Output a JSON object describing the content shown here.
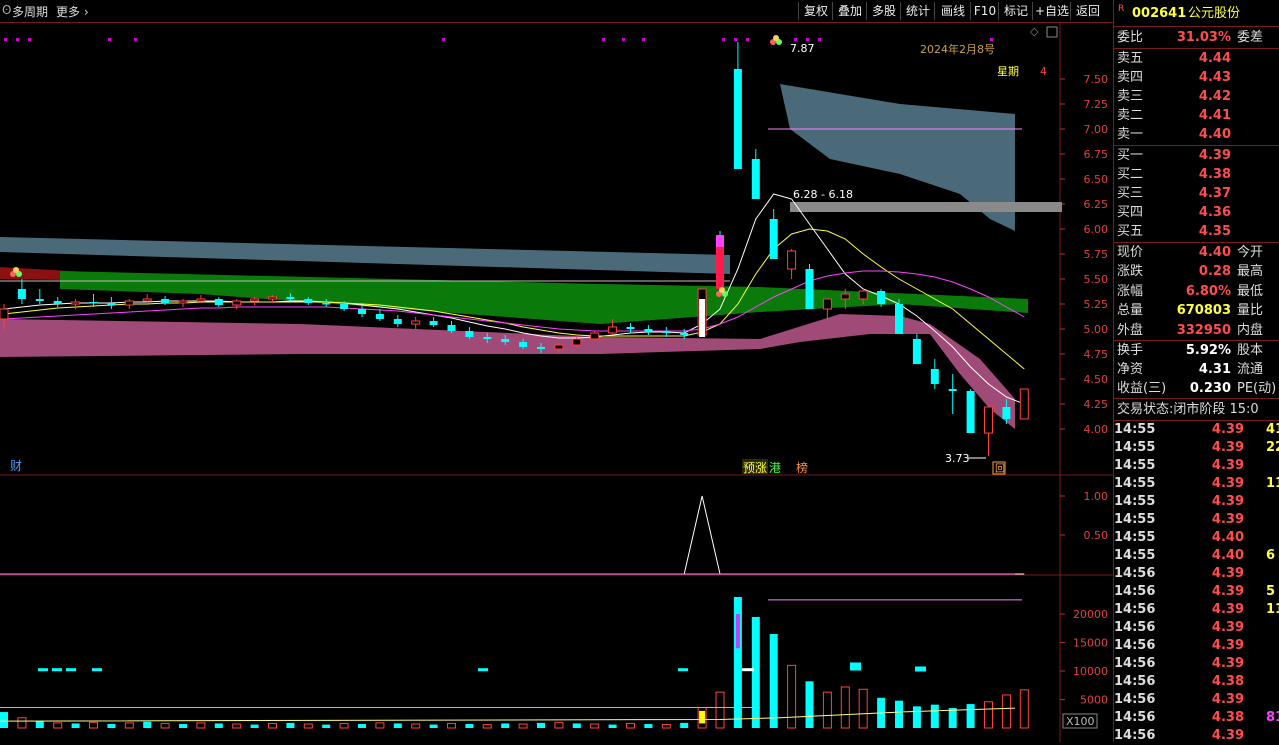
{
  "toolbar": {
    "menu_label": "多周期",
    "more_label": "更多",
    "buttons": [
      "复权",
      "叠加",
      "多股",
      "统计",
      "画线",
      "F10",
      "标记",
      "+自选",
      "返回"
    ]
  },
  "header": {
    "date_label": "2024年2月8号",
    "weekday_label": "星期",
    "weekday_value": "4",
    "high_label": "7.87",
    "low_label": "3.73",
    "range_label": "6.28 - 6.18"
  },
  "markers": {
    "cai": "财",
    "yuzhang": "预涨",
    "gang": "港",
    "bang": "榜",
    "hui": "回",
    "x100": "X100"
  },
  "chart_data": [
    {
      "type": "candlestick",
      "name": "main",
      "ylim": [
        3.6,
        8.0
      ],
      "yticks": [
        4.0,
        4.25,
        4.5,
        4.75,
        5.0,
        5.25,
        5.5,
        5.75,
        6.0,
        6.25,
        6.5,
        6.75,
        7.0,
        7.25,
        7.5
      ],
      "candles": [
        [
          5.1,
          5.25,
          5.0,
          5.2
        ],
        [
          5.4,
          5.5,
          5.25,
          5.3
        ],
        [
          5.3,
          5.4,
          5.25,
          5.28
        ],
        [
          5.28,
          5.32,
          5.22,
          5.25
        ],
        [
          5.25,
          5.3,
          5.2,
          5.27
        ],
        [
          5.27,
          5.35,
          5.22,
          5.26
        ],
        [
          5.26,
          5.32,
          5.2,
          5.24
        ],
        [
          5.24,
          5.3,
          5.2,
          5.28
        ],
        [
          5.28,
          5.35,
          5.25,
          5.3
        ],
        [
          5.3,
          5.33,
          5.24,
          5.26
        ],
        [
          5.26,
          5.3,
          5.22,
          5.28
        ],
        [
          5.28,
          5.34,
          5.26,
          5.3
        ],
        [
          5.3,
          5.32,
          5.22,
          5.24
        ],
        [
          5.24,
          5.3,
          5.2,
          5.28
        ],
        [
          5.28,
          5.32,
          5.24,
          5.3
        ],
        [
          5.3,
          5.34,
          5.26,
          5.32
        ],
        [
          5.32,
          5.36,
          5.28,
          5.3
        ],
        [
          5.3,
          5.32,
          5.24,
          5.26
        ],
        [
          5.26,
          5.3,
          5.22,
          5.25
        ],
        [
          5.25,
          5.28,
          5.18,
          5.2
        ],
        [
          5.2,
          5.24,
          5.12,
          5.15
        ],
        [
          5.15,
          5.2,
          5.08,
          5.1
        ],
        [
          5.1,
          5.14,
          5.02,
          5.05
        ],
        [
          5.05,
          5.12,
          5.0,
          5.08
        ],
        [
          5.08,
          5.12,
          5.02,
          5.04
        ],
        [
          5.04,
          5.08,
          4.96,
          4.98
        ],
        [
          4.98,
          5.02,
          4.9,
          4.92
        ],
        [
          4.92,
          4.96,
          4.86,
          4.9
        ],
        [
          4.9,
          4.94,
          4.84,
          4.87
        ],
        [
          4.87,
          4.9,
          4.8,
          4.82
        ],
        [
          4.82,
          4.86,
          4.76,
          4.8
        ],
        [
          4.8,
          4.86,
          4.76,
          4.84
        ],
        [
          4.84,
          4.92,
          4.82,
          4.9
        ],
        [
          4.9,
          4.98,
          4.88,
          4.96
        ],
        [
          4.96,
          5.1,
          4.94,
          5.02
        ],
        [
          5.02,
          5.06,
          4.96,
          5.0
        ],
        [
          5.0,
          5.04,
          4.94,
          4.98
        ],
        [
          4.98,
          5.02,
          4.92,
          4.96
        ],
        [
          4.96,
          5.0,
          4.9,
          4.94
        ],
        [
          4.94,
          5.4,
          4.92,
          5.4
        ],
        [
          5.94,
          5.98,
          5.4,
          5.4
        ],
        [
          7.6,
          7.87,
          6.6,
          6.6
        ],
        [
          6.7,
          6.8,
          6.3,
          6.3
        ],
        [
          6.1,
          6.2,
          5.7,
          5.7
        ],
        [
          5.6,
          5.8,
          5.5,
          5.78
        ],
        [
          5.6,
          5.65,
          5.2,
          5.2
        ],
        [
          5.2,
          5.3,
          5.1,
          5.3
        ],
        [
          5.3,
          5.4,
          5.2,
          5.35
        ],
        [
          5.3,
          5.4,
          5.25,
          5.38
        ],
        [
          5.38,
          5.4,
          5.22,
          5.25
        ],
        [
          5.25,
          5.3,
          4.95,
          4.95
        ],
        [
          4.9,
          4.95,
          4.65,
          4.65
        ],
        [
          4.6,
          4.7,
          4.4,
          4.45
        ],
        [
          4.4,
          4.55,
          4.15,
          4.38
        ],
        [
          4.38,
          4.4,
          3.96,
          3.96
        ],
        [
          3.96,
          4.22,
          3.73,
          4.22
        ],
        [
          4.22,
          4.3,
          4.05,
          4.1
        ],
        [
          4.1,
          4.4,
          4.1,
          4.4
        ]
      ],
      "ma": [
        [
          5.2,
          5.22,
          5.24,
          5.25,
          5.26,
          5.26,
          5.26,
          5.27,
          5.27,
          5.28,
          5.28,
          5.28,
          5.28,
          5.27,
          5.27,
          5.27,
          5.28,
          5.28,
          5.27,
          5.26,
          5.24,
          5.22,
          5.2,
          5.17,
          5.14,
          5.11,
          5.07,
          5.03,
          5.0,
          4.96,
          4.93,
          4.91,
          4.91,
          4.92,
          4.94,
          4.96,
          4.97,
          4.97,
          4.96,
          5.05,
          5.2,
          5.6,
          6.1,
          6.35,
          6.3,
          6.05,
          5.8,
          5.55,
          5.4,
          5.33,
          5.25,
          5.13,
          4.98,
          4.82,
          4.62,
          4.45,
          4.32,
          4.25
        ],
        [
          5.15,
          5.17,
          5.19,
          5.21,
          5.22,
          5.23,
          5.24,
          5.25,
          5.25,
          5.26,
          5.26,
          5.27,
          5.27,
          5.27,
          5.27,
          5.27,
          5.27,
          5.27,
          5.27,
          5.26,
          5.25,
          5.24,
          5.22,
          5.2,
          5.18,
          5.15,
          5.12,
          5.09,
          5.06,
          5.02,
          4.99,
          4.96,
          4.94,
          4.93,
          4.93,
          4.93,
          4.93,
          4.93,
          4.93,
          4.97,
          5.05,
          5.25,
          5.55,
          5.8,
          5.95,
          6.0,
          5.98,
          5.9,
          5.75,
          5.62,
          5.5,
          5.4,
          5.3,
          5.2,
          5.05,
          4.9,
          4.75,
          4.6
        ],
        [
          5.1,
          5.11,
          5.12,
          5.13,
          5.14,
          5.15,
          5.16,
          5.17,
          5.18,
          5.19,
          5.2,
          5.21,
          5.21,
          5.22,
          5.22,
          5.22,
          5.22,
          5.22,
          5.22,
          5.21,
          5.2,
          5.19,
          5.18,
          5.16,
          5.14,
          5.12,
          5.1,
          5.08,
          5.06,
          5.04,
          5.02,
          5.0,
          4.99,
          4.98,
          4.98,
          4.98,
          4.98,
          4.98,
          4.98,
          5.0,
          5.05,
          5.12,
          5.22,
          5.32,
          5.4,
          5.48,
          5.53,
          5.56,
          5.58,
          5.58,
          5.57,
          5.55,
          5.52,
          5.47,
          5.4,
          5.32,
          5.22,
          5.12
        ]
      ]
    },
    {
      "type": "line",
      "name": "indicator",
      "ylim": [
        0,
        1.25
      ],
      "yticks": [
        0.5,
        1.0
      ],
      "values": [
        0,
        0,
        0,
        0,
        0,
        0,
        0,
        0,
        0,
        0,
        0,
        0,
        0,
        0,
        0,
        0,
        0,
        0,
        0,
        0,
        0,
        0,
        0,
        0,
        0,
        0,
        0,
        0,
        0,
        0,
        0,
        0,
        0,
        0,
        0,
        0,
        0,
        0,
        0,
        1,
        0,
        0,
        0,
        0,
        0,
        0,
        0,
        0,
        0,
        0,
        0,
        0,
        0,
        0,
        0,
        0,
        0,
        0
      ]
    },
    {
      "type": "bar",
      "name": "volume",
      "unit": "X100",
      "ylim": [
        0,
        23000
      ],
      "yticks": [
        5000,
        10000,
        15000,
        20000
      ],
      "values": [
        2800,
        1800,
        1200,
        900,
        800,
        1000,
        700,
        900,
        1100,
        800,
        700,
        900,
        800,
        700,
        600,
        800,
        900,
        700,
        600,
        800,
        700,
        900,
        800,
        700,
        600,
        800,
        700,
        600,
        800,
        700,
        900,
        1000,
        800,
        700,
        600,
        800,
        700,
        600,
        900,
        3600,
        6300,
        23000,
        19500,
        16500,
        11000,
        8200,
        6300,
        7200,
        6800,
        5300,
        4800,
        3800,
        4100,
        3500,
        4200,
        4600,
        5800,
        6700
      ],
      "up": [
        false,
        true,
        false,
        true,
        false,
        true,
        false,
        true,
        false,
        true,
        false,
        true,
        false,
        true,
        false,
        true,
        false,
        true,
        false,
        true,
        false,
        true,
        false,
        true,
        false,
        true,
        false,
        true,
        false,
        true,
        false,
        true,
        false,
        true,
        false,
        true,
        false,
        true,
        false,
        true,
        true,
        false,
        false,
        false,
        true,
        false,
        true,
        true,
        true,
        false,
        false,
        false,
        false,
        false,
        false,
        true,
        true,
        true
      ]
    }
  ],
  "sidebar": {
    "code": "002641",
    "name": "公元股份",
    "weibi_label": "委比",
    "weibi_value": "31.03%",
    "weicha_label": "委差",
    "asks": [
      {
        "label": "卖五",
        "price": "4.44"
      },
      {
        "label": "卖四",
        "price": "4.43"
      },
      {
        "label": "卖三",
        "price": "4.42"
      },
      {
        "label": "卖二",
        "price": "4.41"
      },
      {
        "label": "卖一",
        "price": "4.40"
      }
    ],
    "bids": [
      {
        "label": "买一",
        "price": "4.39"
      },
      {
        "label": "买二",
        "price": "4.38"
      },
      {
        "label": "买三",
        "price": "4.37"
      },
      {
        "label": "买四",
        "price": "4.36"
      },
      {
        "label": "买五",
        "price": "4.35"
      }
    ],
    "stats": [
      {
        "label": "现价",
        "value": "4.40",
        "label2": "今开",
        "color": "red"
      },
      {
        "label": "涨跌",
        "value": "0.28",
        "label2": "最高",
        "color": "red"
      },
      {
        "label": "涨幅",
        "value": "6.80%",
        "label2": "最低",
        "color": "red"
      },
      {
        "label": "总量",
        "value": "670803",
        "label2": "量比",
        "color": "yel"
      },
      {
        "label": "外盘",
        "value": "332950",
        "label2": "内盘",
        "color": "red"
      }
    ],
    "stats2": [
      {
        "label": "换手",
        "value": "5.92%",
        "label2": "股本"
      },
      {
        "label": "净资",
        "value": "4.31",
        "label2": "流通"
      },
      {
        "label": "收益(三)",
        "value": "0.230",
        "label2": "PE(动)"
      }
    ],
    "trade_status": "交易状态:闭市阶段 15:0",
    "ticks": [
      {
        "t": "14:55",
        "p": "4.39",
        "q": "41"
      },
      {
        "t": "14:55",
        "p": "4.39",
        "q": "22"
      },
      {
        "t": "14:55",
        "p": "4.39",
        "q": ""
      },
      {
        "t": "14:55",
        "p": "4.39",
        "q": "11"
      },
      {
        "t": "14:55",
        "p": "4.39",
        "q": ""
      },
      {
        "t": "14:55",
        "p": "4.39",
        "q": ""
      },
      {
        "t": "14:55",
        "p": "4.40",
        "q": ""
      },
      {
        "t": "14:55",
        "p": "4.40",
        "q": "6"
      },
      {
        "t": "14:56",
        "p": "4.39",
        "q": ""
      },
      {
        "t": "14:56",
        "p": "4.39",
        "q": "5"
      },
      {
        "t": "14:56",
        "p": "4.39",
        "q": "11"
      },
      {
        "t": "14:56",
        "p": "4.39",
        "q": ""
      },
      {
        "t": "14:56",
        "p": "4.39",
        "q": ""
      },
      {
        "t": "14:56",
        "p": "4.39",
        "q": ""
      },
      {
        "t": "14:56",
        "p": "4.38",
        "q": ""
      },
      {
        "t": "14:56",
        "p": "4.39",
        "q": ""
      },
      {
        "t": "14:56",
        "p": "4.38",
        "q": "81"
      },
      {
        "t": "14:56",
        "p": "4.39",
        "q": ""
      }
    ]
  }
}
